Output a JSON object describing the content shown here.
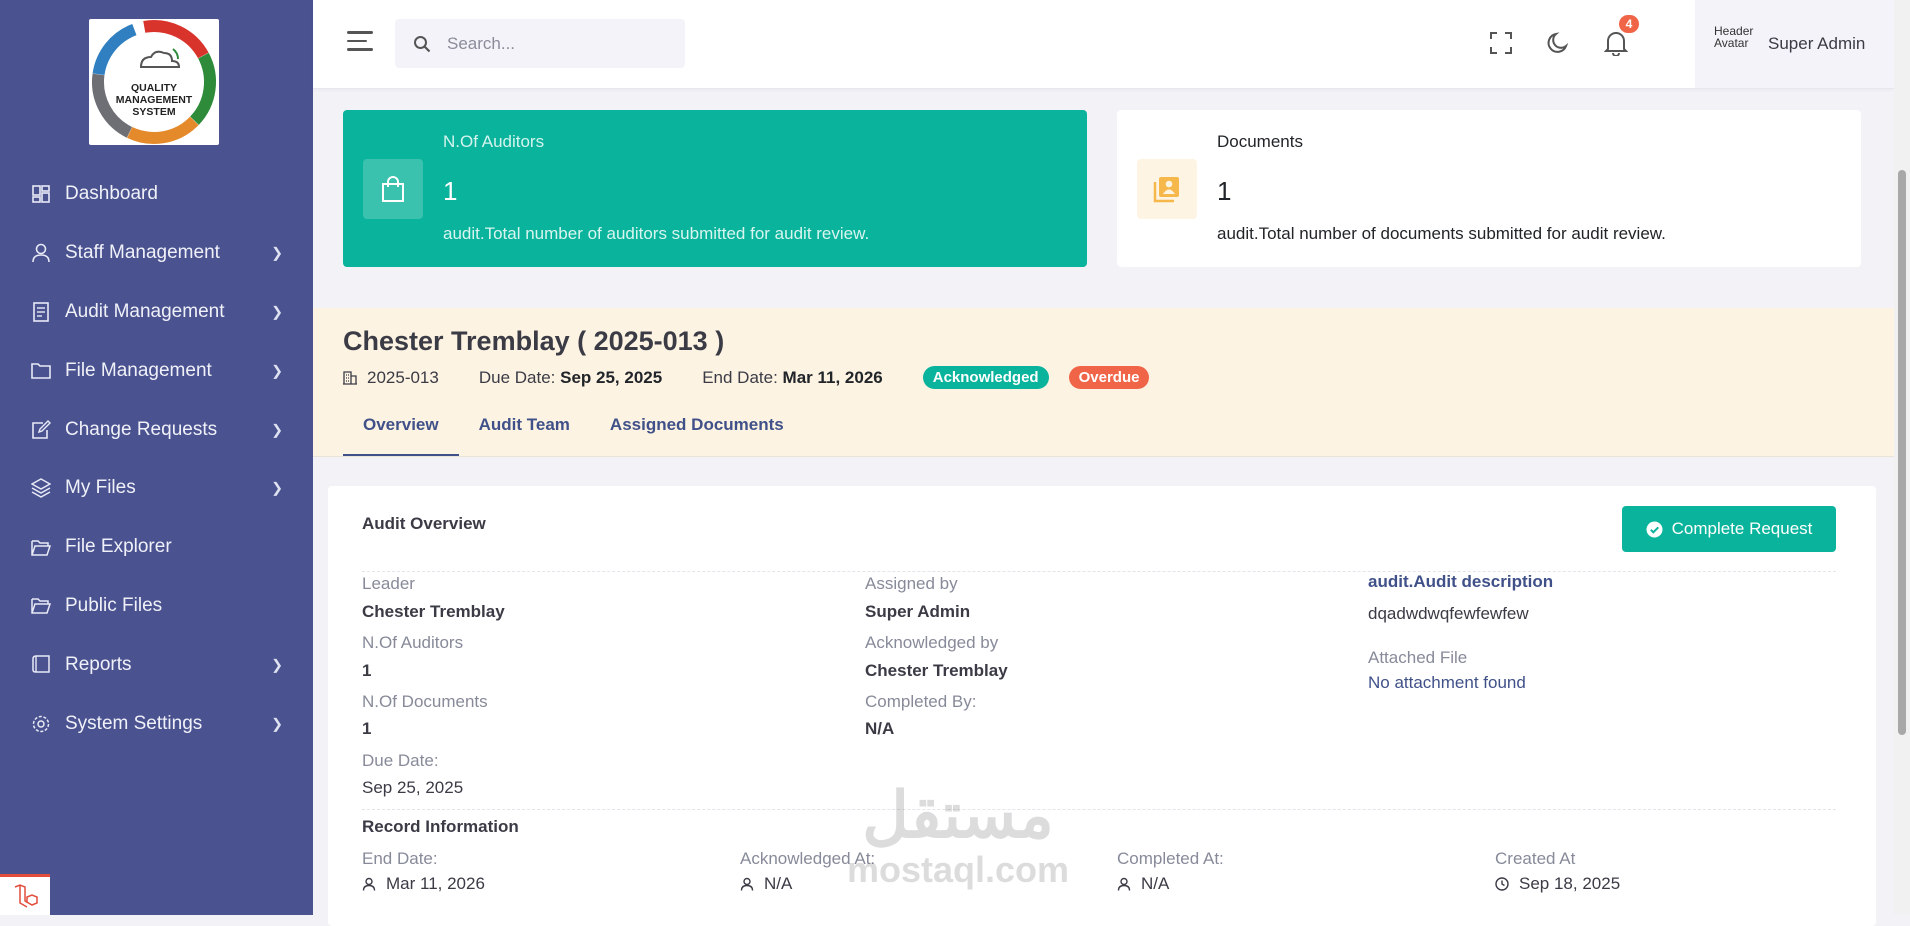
{
  "sidebar": {
    "logo_text": [
      "QUALITY",
      "MANAGEMENT",
      "SYSTEM"
    ],
    "logo_ring_words": [
      "IDENTIFY",
      "DOCUMENT",
      "APPROVE",
      "UPDATE",
      "CHANGE"
    ],
    "items": [
      {
        "label": "Dashboard",
        "icon": "dashboard-icon",
        "has_submenu": false
      },
      {
        "label": "Staff Management",
        "icon": "user-icon",
        "has_submenu": true
      },
      {
        "label": "Audit Management",
        "icon": "document-list-icon",
        "has_submenu": true
      },
      {
        "label": "File Management",
        "icon": "folder-icon",
        "has_submenu": true
      },
      {
        "label": "Change Requests",
        "icon": "edit-document-icon",
        "has_submenu": true
      },
      {
        "label": "My Files",
        "icon": "layers-icon",
        "has_submenu": true
      },
      {
        "label": "File Explorer",
        "icon": "folder-open-icon",
        "has_submenu": false
      },
      {
        "label": "Public Files",
        "icon": "folder-open-icon",
        "has_submenu": false
      },
      {
        "label": "Reports",
        "icon": "book-icon",
        "has_submenu": true
      },
      {
        "label": "System Settings",
        "icon": "gear-icon",
        "has_submenu": true
      }
    ]
  },
  "topbar": {
    "search_placeholder": "Search...",
    "notification_count": "4",
    "avatar_alt": "Header Avatar",
    "user_name": "Super Admin"
  },
  "stats": {
    "auditors": {
      "title": "N.Of Auditors",
      "value": "1",
      "description": "audit.Total number of auditors submitted for audit review."
    },
    "documents": {
      "title": "Documents",
      "value": "1",
      "description": "audit.Total number of documents submitted for audit review."
    }
  },
  "audit": {
    "title": "Chester Tremblay ( 2025-013 )",
    "code": "2025-013",
    "due_label": "Due Date:",
    "due_value": "Sep 25, 2025",
    "end_label": "End Date:",
    "end_value": "Mar 11, 2026",
    "badges": {
      "acknowledged": "Acknowledged",
      "overdue": "Overdue"
    },
    "tabs": [
      "Overview",
      "Audit Team",
      "Assigned Documents"
    ]
  },
  "overview": {
    "title": "Audit Overview",
    "complete_button": "Complete Request",
    "fields": {
      "leader_label": "Leader",
      "leader_value": "Chester Tremblay",
      "auditors_label": "N.Of Auditors",
      "auditors_value": "1",
      "documents_label": "N.Of Documents",
      "documents_value": "1",
      "due_label": "Due Date:",
      "due_value": "Sep 25, 2025",
      "assigned_label": "Assigned by",
      "assigned_value": "Super Admin",
      "ack_label": "Acknowledged by",
      "ack_value": "Chester Tremblay",
      "completed_label": "Completed By:",
      "completed_value": "N/A",
      "desc_label": "audit.Audit description",
      "desc_value": "dqadwdwqfewfewfew",
      "file_label": "Attached File",
      "file_value": "No attachment found"
    },
    "record": {
      "title": "Record Information",
      "end_label": "End Date:",
      "end_value": "Mar 11, 2026",
      "ack_label": "Acknowledged At:",
      "ack_value": "N/A",
      "completed_label": "Completed At:",
      "completed_value": "N/A",
      "created_label": "Created At",
      "created_value": "Sep 18, 2025"
    }
  },
  "watermark": {
    "arabic": "مستقل",
    "latin": "mostaql.com"
  },
  "colors": {
    "sidebar": "#4a5290",
    "accent": "#0ab39c",
    "danger": "#f06548",
    "primary": "#405189",
    "header_band": "#fdf3e3"
  }
}
